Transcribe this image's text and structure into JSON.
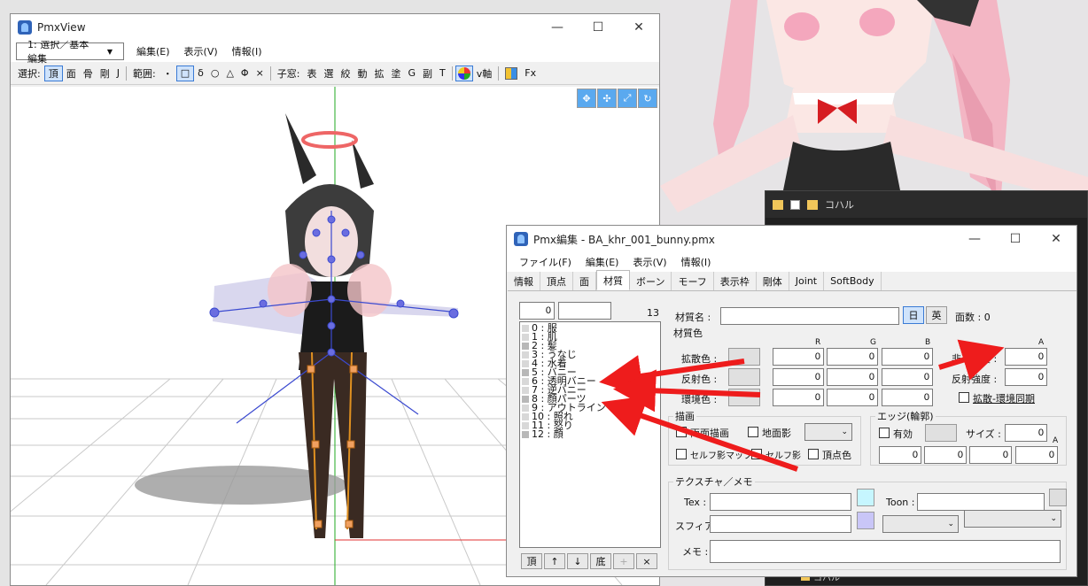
{
  "pmxview": {
    "title": "PmxView",
    "mode_select": "1: 選択／基本編集",
    "menus": [
      "編集(E)",
      "表示(V)",
      "情報(I)"
    ],
    "toolbar": {
      "select_label": "選択:",
      "select_items": [
        "頂",
        "面",
        "骨",
        "剛",
        "J"
      ],
      "range_label": "範囲:",
      "range_items": [
        "・",
        "□",
        "δ",
        "○",
        "△",
        "Φ",
        "×"
      ],
      "child_label": "子窓:",
      "child_items": [
        "表",
        "選",
        "絞",
        "動",
        "拡",
        "塗",
        "G",
        "副",
        "T"
      ],
      "axis_label": "v軸",
      "fx_label": "Fx"
    }
  },
  "background": {
    "explorer_title": "コハル",
    "explorer_item": "コハル"
  },
  "pmxedit": {
    "title": "Pmx編集 - BA_khr_001_bunny.pmx",
    "menus": [
      "ファイル(F)",
      "編集(E)",
      "表示(V)",
      "情報(I)"
    ],
    "tabs": [
      "情報",
      "頂点",
      "面",
      "材質",
      "ボーン",
      "モーフ",
      "表示枠",
      "剛体",
      "Joint",
      "SoftBody"
    ],
    "active_tab": "材質",
    "index_value": "0",
    "count": "13",
    "materials": [
      "0 : 服",
      "1 : 肌",
      "2 : 髪",
      "3 : うなじ",
      "4 : 水着",
      "5 : バニー",
      "6 : 透明バニー",
      "7 : 逆バニー",
      "8 : 顔パーツ",
      "9 : アウトライン",
      "10 : 照れ",
      "11 : 怒り",
      "12 : 顔"
    ],
    "list_buttons": [
      "頂",
      "↑",
      "↓",
      "底",
      "+",
      "×"
    ],
    "material_name_label": "材質名 :",
    "lang_jp": "日",
    "lang_en": "英",
    "face_count_label": "面数 : 0",
    "color_group": "材質色",
    "rgb_headers": [
      "R",
      "G",
      "B"
    ],
    "a_header": "A",
    "diffuse_label": "拡散色 :",
    "specular_label": "反射色 :",
    "ambient_label": "環境色 :",
    "nontransparency_label": "非透過度 :",
    "specular_power_label": "反射強度 :",
    "diffuse_values": [
      "0",
      "0",
      "0"
    ],
    "specular_values": [
      "0",
      "0",
      "0"
    ],
    "ambient_values": [
      "0",
      "0",
      "0"
    ],
    "alpha_value": "0",
    "power_value": "0",
    "sync_label": "拡散-環境同期",
    "draw_group": "描画",
    "double_sided": "両面描画",
    "ground_shadow": "地面影",
    "self_shadow_map": "セルフ影マップ",
    "self_shadow": "セルフ影",
    "vertex_color": "頂点色",
    "edge_group": "エッジ(輪郭)",
    "edge_enable": "有効",
    "edge_size_label": "サイズ :",
    "edge_size": "0",
    "edge_a_label": "A",
    "edge_values": [
      "0",
      "0",
      "0",
      "0"
    ],
    "texture_group": "テクスチャ／メモ",
    "tex_label": "Tex :",
    "toon_label": "Toon :",
    "sphere_label": "スフィア :",
    "memo_label": "メモ :"
  },
  "colors": {
    "arrow": "#ee1c1c",
    "tex_swatch": "#c6f6ff",
    "sphere_swatch": "#c9c6f7",
    "selection_blue": "#3a7bd5",
    "axis_green": "#22aa22",
    "axis_red": "#e03030"
  }
}
